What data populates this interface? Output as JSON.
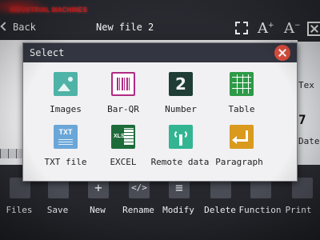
{
  "brand": {
    "text": "INDUSTRIAL MACHINES"
  },
  "header": {
    "back_label": "Back",
    "file_title": "New file 2",
    "icons": [
      "fit-screen-icon",
      "font-larger-icon",
      "font-smaller-icon",
      "close-box-icon"
    ]
  },
  "side_panel": {
    "items": [
      "Tex",
      "7",
      "Date"
    ]
  },
  "dialog": {
    "title": "Select",
    "options": [
      {
        "label": "Images",
        "icon": "image-icon"
      },
      {
        "label": "Bar-QR",
        "icon": "barcode-icon"
      },
      {
        "label": "Number",
        "icon": "number-icon",
        "glyph": "2"
      },
      {
        "label": "Table",
        "icon": "table-icon"
      },
      {
        "label": "TXT file",
        "icon": "txt-file-icon",
        "glyph": "TXT"
      },
      {
        "label": "EXCEL",
        "icon": "excel-icon",
        "glyph": "XLS"
      },
      {
        "label": "Remote data",
        "icon": "remote-data-icon"
      },
      {
        "label": "Paragraph",
        "icon": "paragraph-icon"
      }
    ]
  },
  "toolbar": {
    "items": [
      {
        "label": "Files",
        "glyph": ""
      },
      {
        "label": "Save",
        "glyph": ""
      },
      {
        "label": "New",
        "glyph": "+"
      },
      {
        "label": "Rename",
        "glyph": "</>"
      },
      {
        "label": "Modify",
        "glyph": "≡"
      },
      {
        "label": "Delete",
        "glyph": ""
      },
      {
        "label": "Function",
        "glyph": ""
      },
      {
        "label": "Print",
        "glyph": ""
      }
    ]
  },
  "colors": {
    "dialog_header": "#333640",
    "close_button": "#dc4e3e",
    "toolbar_bg": "#25262c"
  }
}
